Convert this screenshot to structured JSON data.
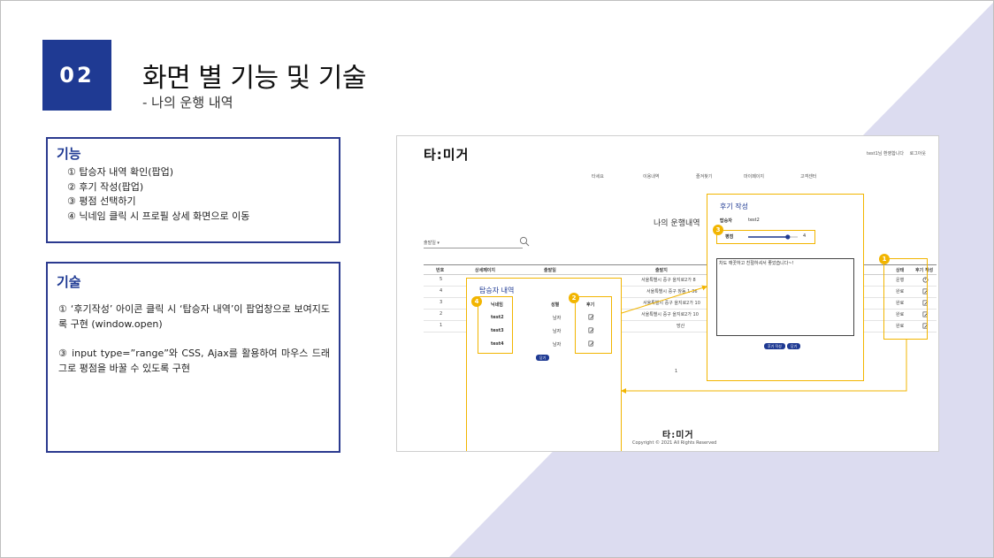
{
  "slide": {
    "number": "02",
    "title": "화면 별 기능 및 기술",
    "subtitle": "- 나의 운행 내역",
    "colors": {
      "accent": "#1f3a93",
      "highlight": "#f2b500",
      "background_triangle": "#dcdcf0"
    }
  },
  "features": {
    "heading": "기능",
    "items": [
      "① 탑승자 내역 확인(팝업)",
      "② 후기 작성(팝업)",
      "③ 평점 선택하기",
      "④ 닉네임 클릭 시 프로필 상세 화면으로 이동"
    ]
  },
  "tech": {
    "heading": "기술",
    "items": [
      "① ‘후기작성’ 아이콘 클릭 시 ‘탑승자 내역’이 팝업창으로 보여지도록 구현 (window.open)",
      "③ input type=”range”와 CSS, Ajax를 활용하여 마우스 드래그로 평점을 바꿀 수 있도록 구현"
    ]
  },
  "screenshot": {
    "logo": "타:미거",
    "user_greeting": "test1님 환영합니다",
    "logout": "로그아웃",
    "nav": [
      "타세요",
      "이용내역",
      "즐겨찾기",
      "마이페이지",
      "고객센터"
    ],
    "page_heading": "나의 운행내역",
    "select_label": "출발일 ▾",
    "search_icon": "magnifier-icon",
    "table_headers": [
      "번호",
      "상세페이지",
      "출발일",
      "출발지",
      "상태",
      "후기 작성"
    ],
    "rows": [
      {
        "no": "5",
        "origin": "서울특별시 중구 을지로2가 8",
        "status": "운행"
      },
      {
        "no": "4",
        "origin": "서울특별시 중구 창동 1-36",
        "status": "완료"
      },
      {
        "no": "3",
        "origin": "서울특별시 중구 을지로2가 10",
        "status": "완료"
      },
      {
        "no": "2",
        "origin": "서울특별시 중구 을지로2가 10",
        "status": "완료"
      },
      {
        "no": "1",
        "origin": "망산",
        "status": "완료"
      }
    ],
    "pager": "1",
    "footer_logo": "타:미거",
    "footer_copyright": "Copyright © 2021 All Rights Reserved"
  },
  "passenger_popup": {
    "title": "탑승자 내역",
    "headers": [
      "닉네임",
      "성별",
      "후기"
    ],
    "rows": [
      {
        "nickname": "test2",
        "gender": "남자"
      },
      {
        "nickname": "test3",
        "gender": "남자"
      },
      {
        "nickname": "test4",
        "gender": "남자"
      }
    ],
    "close_label": "닫기"
  },
  "review_popup": {
    "title": "후기 작성",
    "passenger_label": "탑승자",
    "passenger_value": "test2",
    "rating_label": "평점",
    "rating_value": "4",
    "rating_fraction": 0.8,
    "review_text": "차도 깨끗하고 친절하셔서 좋았습니다~!",
    "submit_label": "후기 작성",
    "close_label": "닫기"
  },
  "badges": {
    "b1": "1",
    "b2": "2",
    "b3": "3",
    "b4": "4"
  }
}
